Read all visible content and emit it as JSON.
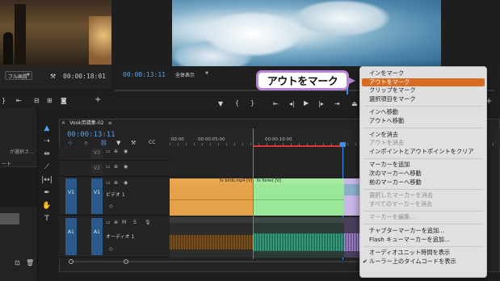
{
  "source_monitor": {
    "zoom": "フル画質",
    "timecode": "00:00:18:01"
  },
  "program_monitor": {
    "timecode": "00:00:13:11",
    "zoom": "全体表示"
  },
  "left_panel": {
    "hint_text": "が選択さ...",
    "row_text": "ート"
  },
  "timeline": {
    "tab_label": "Vook用請集-02",
    "timecode": "00:00:13:11",
    "ruler_labels": [
      ":00:00",
      "00:00:05:00",
      "00:00:10:00"
    ],
    "tracks": {
      "v3": "V3",
      "v2": "V2",
      "v1_source": "V1",
      "v1": "V1",
      "v1_name": "ビデオ 1",
      "a1_source": "A1",
      "a1": "A1",
      "a1_name": "オーディオ 1",
      "m": "M",
      "s": "S"
    },
    "clips": {
      "clip1": "birds.mp4 [V]",
      "clip2": "forest [V]",
      "fx": "fx"
    }
  },
  "callout": {
    "text": "アウトをマーク"
  },
  "context_menu": {
    "items": [
      {
        "label": "インをマーク"
      },
      {
        "label": "アウトをマーク",
        "highlighted": true
      },
      {
        "label": "クリップをマーク"
      },
      {
        "label": "選択項目をマーク"
      },
      {
        "separator": true
      },
      {
        "label": "インへ移動"
      },
      {
        "label": "アウトへ移動"
      },
      {
        "separator": true
      },
      {
        "label": "インを消去"
      },
      {
        "label": "アウトを消去",
        "disabled": true
      },
      {
        "label": "インポイントとアウトポイントをクリア"
      },
      {
        "separator": true
      },
      {
        "label": "マーカーを追加"
      },
      {
        "label": "次のマーカーへ移動"
      },
      {
        "label": "前のマーカーへ移動"
      },
      {
        "separator": true
      },
      {
        "label": "選択したマーカーを消去",
        "disabled": true
      },
      {
        "label": "すべてのマーカーを消去",
        "disabled": true
      },
      {
        "separator": true
      },
      {
        "label": "マーカーを編集...",
        "disabled": true
      },
      {
        "separator": true
      },
      {
        "label": "チャプターマーカーを追加..."
      },
      {
        "label": "Flash キューマーカーを追加..."
      },
      {
        "separator": true
      },
      {
        "label": "オーディオユニット時間を表示"
      },
      {
        "label": "ルーラー上のタイムコードを表示",
        "checked": true
      }
    ]
  },
  "colors": {
    "timecode_blue": "#5aa0e6",
    "clip_orange": "#e6a24a",
    "clip_green": "#9be79a",
    "clip_lavender": "#c9b7e8",
    "audio_wave": "#5fd2b3",
    "menu_highlight": "#d76c24",
    "callout_border": "#b883d9",
    "playhead": "#3c8ee6",
    "inout_red": "#e0363a"
  }
}
